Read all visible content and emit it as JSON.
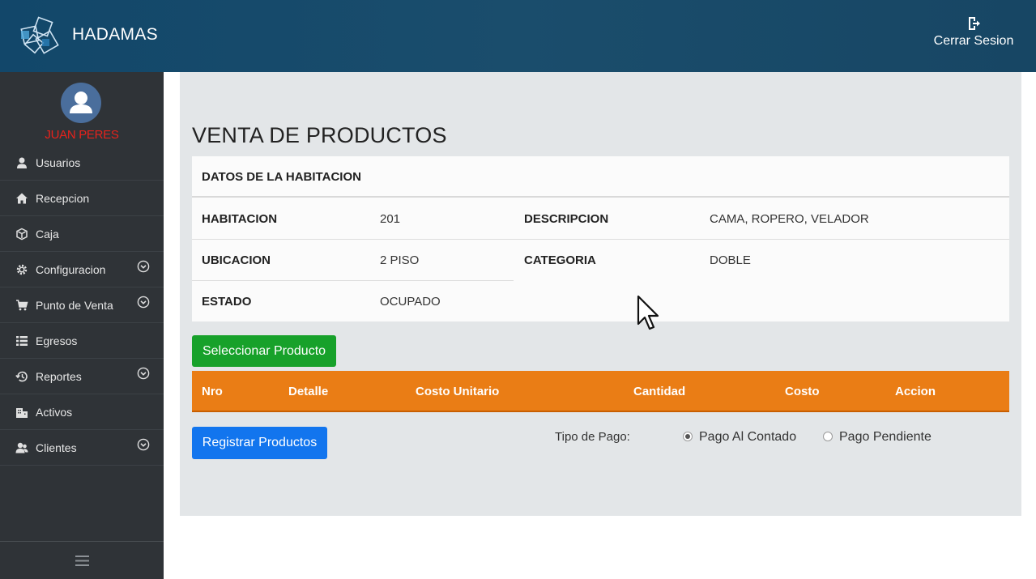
{
  "header": {
    "brand": "HADAMAS",
    "logout_label": "Cerrar Sesion",
    "logout_icon": "logout-icon"
  },
  "sidebar": {
    "user_name": "JUAN PERES",
    "items": [
      {
        "label": "Usuarios",
        "icon": "user-icon",
        "expandable": false
      },
      {
        "label": "Recepcion",
        "icon": "home-icon",
        "expandable": false
      },
      {
        "label": "Caja",
        "icon": "box-icon",
        "expandable": false
      },
      {
        "label": "Configuracion",
        "icon": "gear-icon",
        "expandable": true
      },
      {
        "label": "Punto de Venta",
        "icon": "cart-icon",
        "expandable": true
      },
      {
        "label": "Egresos",
        "icon": "list-icon",
        "expandable": false
      },
      {
        "label": "Reportes",
        "icon": "history-icon",
        "expandable": true
      },
      {
        "label": "Activos",
        "icon": "building-icon",
        "expandable": false
      },
      {
        "label": "Clientes",
        "icon": "clients-icon",
        "expandable": true
      }
    ],
    "footer_icon": "hamburger-icon"
  },
  "main": {
    "title": "VENTA DE PRODUCTOS",
    "room_card": {
      "heading": "DATOS DE LA HABITACION",
      "habitacion_label": "HABITACION",
      "habitacion_value": "201",
      "descripcion_label": "DESCRIPCION",
      "descripcion_value": "CAMA, ROPERO, VELADOR",
      "ubicacion_label": "UBICACION",
      "ubicacion_value": "2 PISO",
      "categoria_label": "CATEGORIA",
      "categoria_value": "DOBLE",
      "estado_label": "ESTADO",
      "estado_value": "OCUPADO"
    },
    "select_product_button": "Seleccionar Producto",
    "table": {
      "columns": [
        "Nro",
        "Detalle",
        "Costo Unitario",
        "Cantidad",
        "Costo",
        "Accion"
      ],
      "rows": []
    },
    "register_button": "Registrar Productos",
    "payment": {
      "label": "Tipo de Pago:",
      "options": [
        "Pago Al Contado",
        "Pago Pendiente"
      ],
      "selected": "Pago Al Contado"
    }
  },
  "colors": {
    "header": "#174664",
    "sidebar": "#2f3337",
    "username": "#e8221c",
    "table_header": "#ea7d15",
    "button_green": "#17a12a",
    "button_blue": "#1275ee"
  }
}
